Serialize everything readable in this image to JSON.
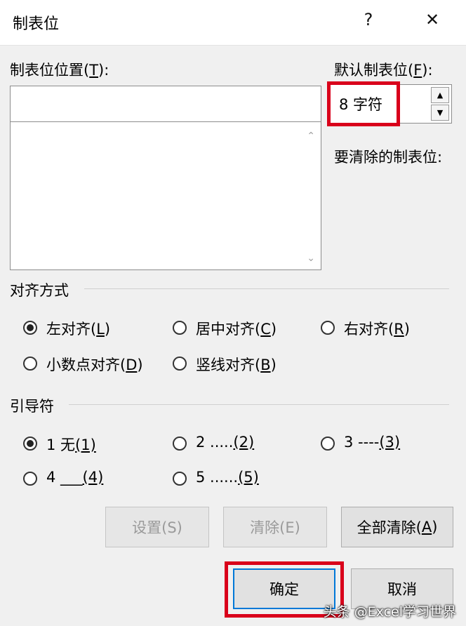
{
  "window": {
    "title": "制表位",
    "help_glyph": "?",
    "close_glyph": "✕"
  },
  "tab_position": {
    "label_main": "制表位位置(",
    "label_key": "T",
    "label_end": "):",
    "value": ""
  },
  "default_tab": {
    "label_main": "默认制表位(",
    "label_key": "F",
    "label_end": "):",
    "value": "8 字符"
  },
  "to_clear": {
    "label": "要清除的制表位:"
  },
  "alignment": {
    "title": "对齐方式",
    "options": [
      {
        "pre": "左对齐(",
        "key": "L",
        "post": ")",
        "checked": true
      },
      {
        "pre": "居中对齐(",
        "key": "C",
        "post": ")",
        "checked": false
      },
      {
        "pre": "右对齐(",
        "key": "R",
        "post": ")",
        "checked": false
      },
      {
        "pre": "小数点对齐(",
        "key": "D",
        "post": ")",
        "checked": false
      },
      {
        "pre": "竖线对齐(",
        "key": "B",
        "post": ")",
        "checked": false
      }
    ]
  },
  "leader": {
    "title": "引导符",
    "options": [
      {
        "pre": "1 无",
        "key": "(1)",
        "checked": true
      },
      {
        "pre": "2 .....",
        "key": "(2)",
        "checked": false
      },
      {
        "pre": "3 ----",
        "key": "(3)",
        "checked": false
      },
      {
        "pre": "4 ___",
        "key": "(4)",
        "checked": false
      },
      {
        "pre": "5 ......",
        "key": "(5)",
        "checked": false
      }
    ]
  },
  "buttons": {
    "set": "设置(S)",
    "clear": "清除(E)",
    "clear_all_pre": "全部清除(",
    "clear_all_key": "A",
    "clear_all_post": ")",
    "ok": "确定",
    "cancel": "取消"
  },
  "watermark": "头条 @Excel学习世界",
  "colors": {
    "highlight": "#d9001b",
    "default_button_border": "#0078d7"
  }
}
